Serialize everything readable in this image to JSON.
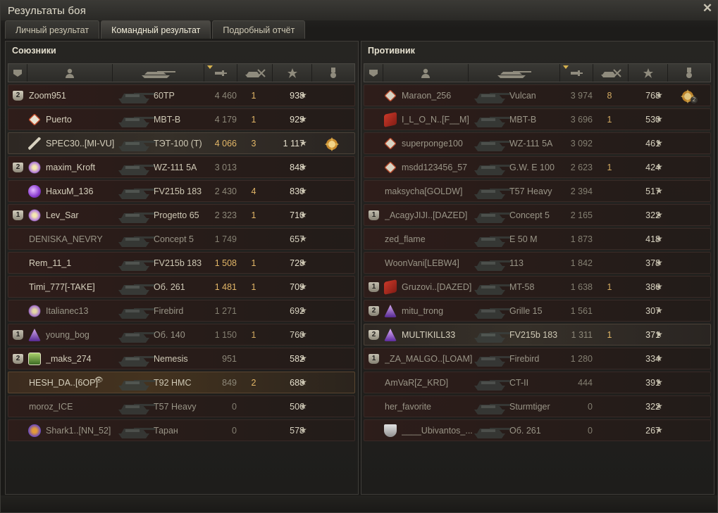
{
  "window": {
    "title": "Результаты боя",
    "close_label": "✕"
  },
  "tabs": [
    {
      "label": "Личный результат",
      "active": false
    },
    {
      "label": "Командный результат",
      "active": true
    },
    {
      "label": "Подробный отчёт",
      "active": false
    }
  ],
  "columns": [
    "squad",
    "player",
    "tank",
    "damage",
    "frags",
    "xp",
    "medals"
  ],
  "allies": {
    "title": "Союзники",
    "rows": [
      {
        "squad": "2",
        "clan": "",
        "name": "Zoom951",
        "tank": "60TP",
        "damage": "4 460",
        "frags": "1",
        "xp": "938",
        "medal": "",
        "style": "normal"
      },
      {
        "squad": "",
        "clan": "c-diamond",
        "name": "Puerto",
        "tank": "MBT-B",
        "damage": "4 179",
        "frags": "1",
        "xp": "929",
        "medal": "",
        "style": "normal"
      },
      {
        "squad": "",
        "clan": "c-sword",
        "name": "SPEC30..[MI-VU]",
        "tank": "ТЭТ-100 (Т)",
        "damage": "4 066",
        "frags": "3",
        "xp": "1 117",
        "medal": "medal-gold",
        "style": "hl",
        "dmg_gold": true
      },
      {
        "squad": "2",
        "clan": "c-star",
        "name": "maxim_Kroft",
        "tank": "WZ-111 5A",
        "damage": "3 013",
        "frags": "",
        "xp": "848",
        "medal": "",
        "style": "normal"
      },
      {
        "squad": "",
        "clan": "c-purple",
        "name": "HaxuM_136",
        "tank": "FV215b 183",
        "damage": "2 430",
        "frags": "4",
        "xp": "830",
        "medal": "",
        "style": "normal"
      },
      {
        "squad": "1",
        "clan": "c-star",
        "name": "Lev_Sar",
        "tank": "Progetto 65",
        "damage": "2 323",
        "frags": "1",
        "xp": "710",
        "medal": "",
        "style": "normal"
      },
      {
        "squad": "",
        "clan": "",
        "name": "DENISKA_NEVRY",
        "tank": "Concept 5",
        "damage": "1 749",
        "frags": "",
        "xp": "657",
        "medal": "",
        "style": "dead"
      },
      {
        "squad": "",
        "clan": "",
        "name": "Rem_11_1",
        "tank": "FV215b 183",
        "damage": "1 508",
        "frags": "1",
        "xp": "728",
        "medal": "",
        "style": "normal",
        "dmg_gold": true
      },
      {
        "squad": "",
        "clan": "",
        "name": "Timi_777[-TAKE]",
        "tank": "Об. 261",
        "damage": "1 481",
        "frags": "1",
        "xp": "709",
        "medal": "",
        "style": "normal",
        "dmg_gold": true
      },
      {
        "squad": "",
        "clan": "c-star",
        "name": "Italianec13",
        "tank": "Firebird",
        "damage": "1 271",
        "frags": "",
        "xp": "692",
        "medal": "",
        "style": "dead"
      },
      {
        "squad": "1",
        "clan": "c-tri",
        "name": "young_bog",
        "tank": "Об. 140",
        "damage": "1 150",
        "frags": "1",
        "xp": "760",
        "medal": "",
        "style": "dead"
      },
      {
        "squad": "2",
        "clan": "c-badge",
        "name": "_maks_274",
        "tank": "Nemesis",
        "damage": "951",
        "frags": "",
        "xp": "582",
        "medal": "",
        "style": "normal"
      },
      {
        "squad": "",
        "clan": "",
        "name": "HESH_DA..[6OP]",
        "tank": "T92 HMC",
        "damage": "849",
        "frags": "2",
        "xp": "688",
        "medal": "",
        "style": "self",
        "eye": true
      },
      {
        "squad": "",
        "clan": "",
        "name": "moroz_ICE",
        "tank": "T57 Heavy",
        "damage": "0",
        "frags": "",
        "xp": "506",
        "medal": "",
        "style": "dead"
      },
      {
        "squad": "",
        "clan": "c-red",
        "name": "Shark1..[NN_52]",
        "tank": "Таран",
        "damage": "0",
        "frags": "",
        "xp": "578",
        "medal": "",
        "style": "dead"
      }
    ]
  },
  "enemies": {
    "title": "Противник",
    "rows": [
      {
        "squad": "",
        "clan": "c-diamond",
        "name": "Maraon_256",
        "tank": "Vulcan",
        "damage": "3 974",
        "frags": "8",
        "xp": "768",
        "medal": "medal-gold-2",
        "medal_count": "2",
        "style": "dead"
      },
      {
        "squad": "",
        "clan": "c-flag",
        "name": "I_L_O_N..[F__M]",
        "tank": "MBT-B",
        "damage": "3 696",
        "frags": "1",
        "xp": "530",
        "medal": "",
        "style": "dead"
      },
      {
        "squad": "",
        "clan": "c-diamond",
        "name": "superponge100",
        "tank": "WZ-111 5A",
        "damage": "3 092",
        "frags": "",
        "xp": "461",
        "medal": "",
        "style": "dead"
      },
      {
        "squad": "",
        "clan": "c-diamond",
        "name": "msdd123456_57",
        "tank": "G.W. E 100",
        "damage": "2 623",
        "frags": "1",
        "xp": "424",
        "medal": "",
        "style": "dead"
      },
      {
        "squad": "",
        "clan": "",
        "name": "maksycha[GOLDW]",
        "tank": "T57 Heavy",
        "damage": "2 394",
        "frags": "",
        "xp": "517",
        "medal": "",
        "style": "dead"
      },
      {
        "squad": "1",
        "clan": "",
        "name": "_AcagyJIJI..[DAZED]",
        "tank": "Concept 5",
        "damage": "2 165",
        "frags": "",
        "xp": "322",
        "medal": "",
        "style": "dead"
      },
      {
        "squad": "",
        "clan": "",
        "name": "zed_flame",
        "tank": "E 50 M",
        "damage": "1 873",
        "frags": "",
        "xp": "418",
        "medal": "",
        "style": "dead"
      },
      {
        "squad": "",
        "clan": "",
        "name": "WoonVani[LEBW4]",
        "tank": "113",
        "damage": "1 842",
        "frags": "",
        "xp": "378",
        "medal": "",
        "style": "dead"
      },
      {
        "squad": "1",
        "clan": "c-flag",
        "name": "Gruzovi..[DAZED]",
        "tank": "MT-58",
        "damage": "1 638",
        "frags": "1",
        "xp": "386",
        "medal": "",
        "style": "dead"
      },
      {
        "squad": "2",
        "clan": "c-tri",
        "name": "mitu_trong",
        "tank": "Grille 15",
        "damage": "1 561",
        "frags": "",
        "xp": "307",
        "medal": "",
        "style": "dead"
      },
      {
        "squad": "2",
        "clan": "c-tri",
        "name": "MULTIKILL33",
        "tank": "FV215b 183",
        "damage": "1 311",
        "frags": "1",
        "xp": "371",
        "medal": "",
        "style": "hl"
      },
      {
        "squad": "1",
        "clan": "",
        "name": "_ZA_MALGO..[LOAM]",
        "tank": "Firebird",
        "damage": "1 280",
        "frags": "",
        "xp": "334",
        "medal": "",
        "style": "dead"
      },
      {
        "squad": "",
        "clan": "",
        "name": "AmVaR[Z_KRD]",
        "tank": "CT-II",
        "damage": "444",
        "frags": "",
        "xp": "391",
        "medal": "",
        "style": "dead"
      },
      {
        "squad": "",
        "clan": "",
        "name": "her_favorite",
        "tank": "Sturmtiger",
        "damage": "0",
        "frags": "",
        "xp": "322",
        "medal": "",
        "style": "dead"
      },
      {
        "squad": "",
        "clan": "c-silver",
        "name": "____Ubivantos_...",
        "tank": "Об. 261",
        "damage": "0",
        "frags": "",
        "xp": "267",
        "medal": "",
        "style": "dead"
      }
    ]
  },
  "colors": {
    "accent_gold": "#e2b667",
    "ally_row": "#2f1d1a",
    "self_row": "#44331f"
  }
}
